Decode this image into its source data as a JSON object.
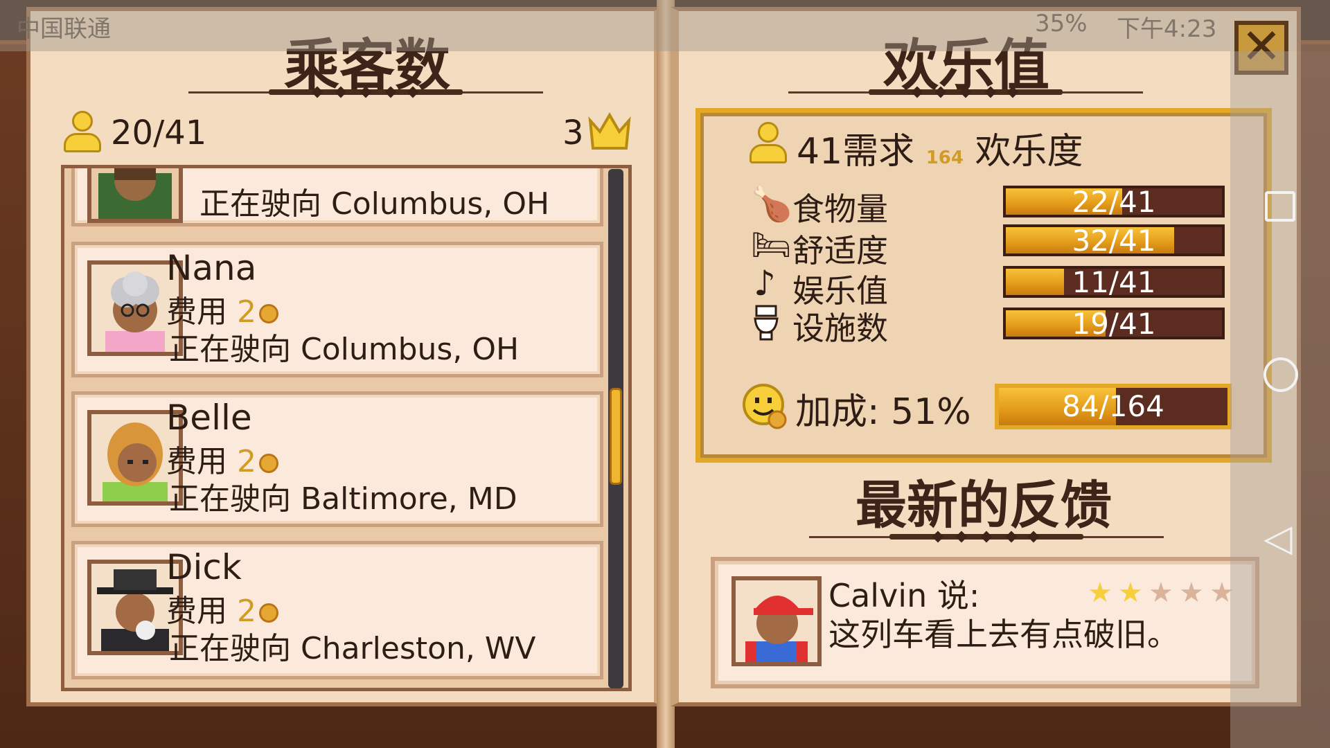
{
  "statusbar": {
    "carrier": "中国联通",
    "battery": "35%",
    "time": "下午4:23"
  },
  "left_page": {
    "title": "乘客数",
    "passenger_count": "20/41",
    "crown_count": "3"
  },
  "passengers": [
    {
      "name": "",
      "fee_label": "",
      "fee_value": "",
      "destination": "正在驶向 Columbus, OH"
    },
    {
      "name": "Nana",
      "fee_label": "费用",
      "fee_value": "2",
      "destination": "正在驶向 Columbus, OH"
    },
    {
      "name": "Belle",
      "fee_label": "费用",
      "fee_value": "2",
      "destination": "正在驶向 Baltimore, MD"
    },
    {
      "name": "Dick",
      "fee_label": "费用",
      "fee_value": "2",
      "destination": "正在驶向 Charleston, WV"
    }
  ],
  "right_page": {
    "title": "欢乐值",
    "demand_prefix": "41需求",
    "demand_small": "164",
    "demand_suffix": "欢乐度",
    "stats": [
      {
        "label": "食物量",
        "value_text": "22/41",
        "fraction": 0.537,
        "icon": "drumstick-icon"
      },
      {
        "label": "舒适度",
        "value_text": "32/41",
        "fraction": 0.78,
        "icon": "bed-icon"
      },
      {
        "label": "娱乐值",
        "value_text": "11/41",
        "fraction": 0.268,
        "icon": "music-note-icon"
      },
      {
        "label": "设施数",
        "value_text": "19/41",
        "fraction": 0.463,
        "icon": "toilet-icon"
      }
    ],
    "bonus_label": "加成: 51%",
    "bonus_value_text": "84/164",
    "bonus_fraction": 0.512,
    "feedback_title": "最新的反馈",
    "feedback": {
      "speaker": "Calvin 说:",
      "text": "这列车看上去有点破旧。",
      "rating": 2,
      "max_rating": 5
    }
  },
  "close_label": "✕",
  "colors": {
    "page": "#f3dcc0",
    "gold": "#e3a826",
    "bar_bg": "#5c2c20",
    "text_dark": "#2e1d14"
  }
}
